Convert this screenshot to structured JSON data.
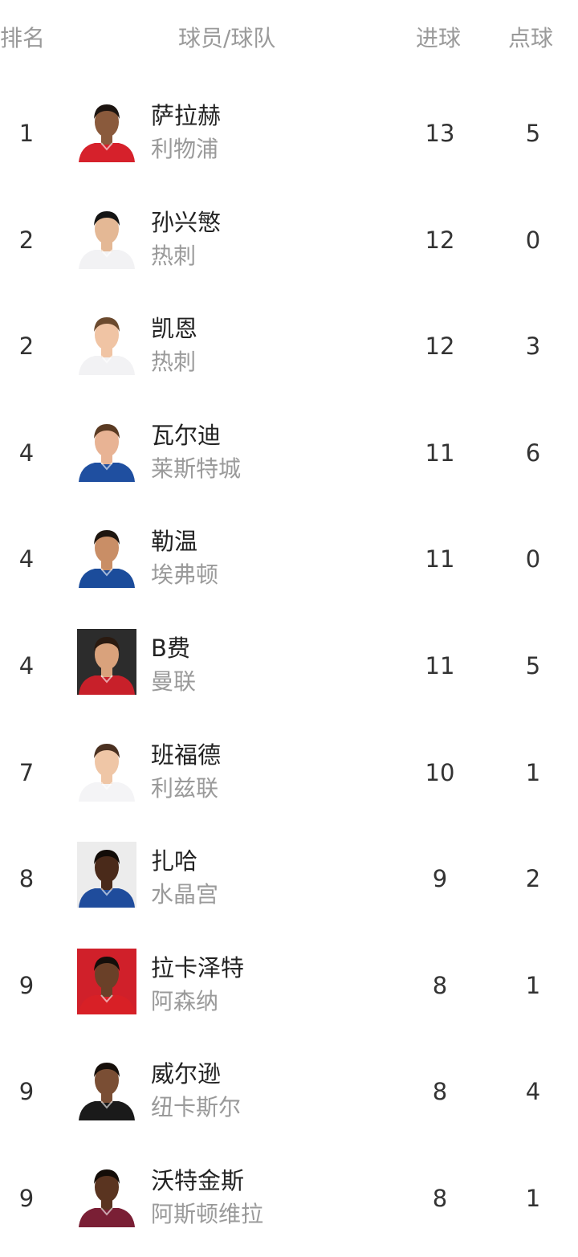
{
  "header": {
    "rank": "排名",
    "player_team": "球员/球队",
    "goals": "进球",
    "penalties": "点球"
  },
  "rows": [
    {
      "rank": "1",
      "name": "萨拉赫",
      "team": "利物浦",
      "goals": "13",
      "penalties": "5",
      "avatar": "player-photo-icon",
      "kit_color": "#d6212b",
      "bg_color": "#ffffff",
      "skin": "#8a5a3c",
      "hair": "#1c1410"
    },
    {
      "rank": "2",
      "name": "孙兴慜",
      "team": "热刺",
      "goals": "12",
      "penalties": "0",
      "avatar": "player-photo-icon",
      "kit_color": "#f2f2f4",
      "bg_color": "#ffffff",
      "skin": "#e4b895",
      "hair": "#141414"
    },
    {
      "rank": "2",
      "name": "凯恩",
      "team": "热刺",
      "goals": "12",
      "penalties": "3",
      "avatar": "player-photo-icon",
      "kit_color": "#f2f2f4",
      "bg_color": "#ffffff",
      "skin": "#f0c4a4",
      "hair": "#6b4a2e"
    },
    {
      "rank": "4",
      "name": "瓦尔迪",
      "team": "莱斯特城",
      "goals": "11",
      "penalties": "6",
      "avatar": "player-photo-icon",
      "kit_color": "#1f4fa0",
      "bg_color": "#ffffff",
      "skin": "#e8b394",
      "hair": "#5a3a22"
    },
    {
      "rank": "4",
      "name": "勒温",
      "team": "埃弗顿",
      "goals": "11",
      "penalties": "0",
      "avatar": "player-photo-icon",
      "kit_color": "#1b4c9b",
      "bg_color": "#ffffff",
      "skin": "#c98e66",
      "hair": "#1e1610"
    },
    {
      "rank": "4",
      "name": "B费",
      "team": "曼联",
      "goals": "11",
      "penalties": "5",
      "avatar": "player-photo-icon",
      "kit_color": "#c8202a",
      "bg_color": "#2c2c2c",
      "skin": "#d9a27c",
      "hair": "#2a1a10"
    },
    {
      "rank": "7",
      "name": "班福德",
      "team": "利兹联",
      "goals": "10",
      "penalties": "1",
      "avatar": "player-photo-icon",
      "kit_color": "#f4f4f6",
      "bg_color": "#ffffff",
      "skin": "#efc6a6",
      "hair": "#4a3020"
    },
    {
      "rank": "8",
      "name": "扎哈",
      "team": "水晶宫",
      "goals": "9",
      "penalties": "2",
      "avatar": "player-photo-icon",
      "kit_color": "#1f4c9c",
      "bg_color": "#ececec",
      "skin": "#4a2a1a",
      "hair": "#120c08"
    },
    {
      "rank": "9",
      "name": "拉卡泽特",
      "team": "阿森纳",
      "goals": "8",
      "penalties": "1",
      "avatar": "player-photo-icon",
      "kit_color": "#d82026",
      "bg_color": "#d0202a",
      "skin": "#6a4028",
      "hair": "#140e0a"
    },
    {
      "rank": "9",
      "name": "威尔逊",
      "team": "纽卡斯尔",
      "goals": "8",
      "penalties": "4",
      "avatar": "player-photo-icon",
      "kit_color": "#1a1a1a",
      "bg_color": "#ffffff",
      "skin": "#7a4e34",
      "hair": "#160f0a"
    },
    {
      "rank": "9",
      "name": "沃特金斯",
      "team": "阿斯顿维拉",
      "goals": "8",
      "penalties": "1",
      "avatar": "player-photo-icon",
      "kit_color": "#7a1f35",
      "bg_color": "#ffffff",
      "skin": "#5a3420",
      "hair": "#140d08"
    }
  ]
}
